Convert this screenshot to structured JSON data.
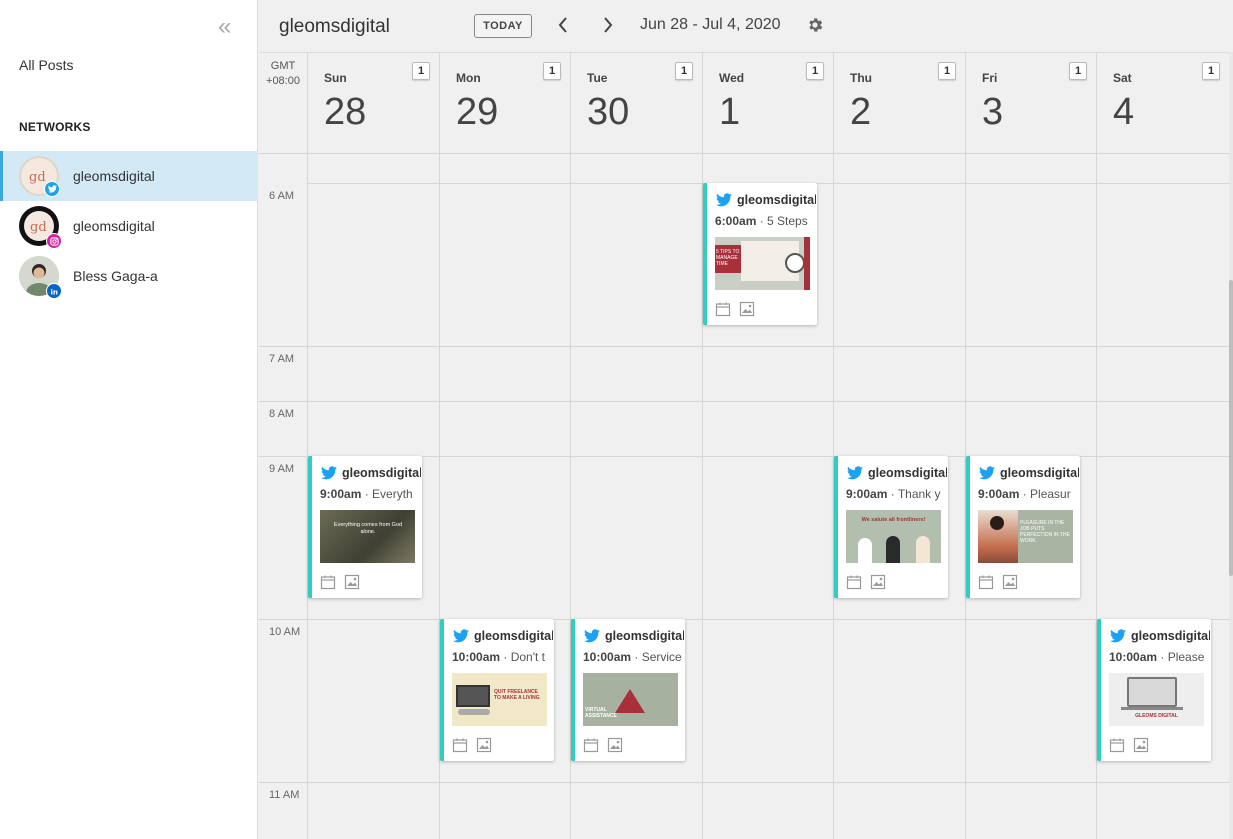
{
  "sidebar": {
    "all_posts": "All Posts",
    "networks_label": "NETWORKS",
    "networks": [
      {
        "name": "gleomsdigital",
        "network": "twitter",
        "avatar_text": "gd"
      },
      {
        "name": "gleomsdigital",
        "network": "instagram",
        "avatar_text": "gd"
      },
      {
        "name": "Bless Gaga-a",
        "network": "linkedin",
        "avatar_text": ""
      }
    ]
  },
  "topbar": {
    "brand": "gleomsdigital",
    "today_label": "TODAY",
    "prev_icon": "chevron-left-icon",
    "next_icon": "chevron-right-icon",
    "date_range": "Jun 28 - Jul 4, 2020",
    "settings_icon": "gear-icon"
  },
  "calendar": {
    "timezone": "GMT\n+08:00",
    "days": [
      {
        "name": "Sun",
        "num": "28",
        "count": "1"
      },
      {
        "name": "Mon",
        "num": "29",
        "count": "1"
      },
      {
        "name": "Tue",
        "num": "30",
        "count": "1"
      },
      {
        "name": "Wed",
        "num": "1",
        "count": "1"
      },
      {
        "name": "Thu",
        "num": "2",
        "count": "1"
      },
      {
        "name": "Fri",
        "num": "3",
        "count": "1"
      },
      {
        "name": "Sat",
        "num": "4",
        "count": "1"
      }
    ],
    "hours": [
      "6 AM",
      "7 AM",
      "8 AM",
      "9 AM",
      "10 AM",
      "11 AM"
    ],
    "posts": [
      {
        "day": 3,
        "hour": 6,
        "account": "gleomsdigital",
        "time": "6:00am",
        "snippet": " · 5 Steps",
        "thumb_color": "#c9cfc4",
        "thumb_text": "5 TIPS TO MANAGE TIME"
      },
      {
        "day": 0,
        "hour": 9,
        "account": "gleomsdigital",
        "time": "9:00am",
        "snippet": " · Everyth",
        "thumb_color": "#5a5e4c",
        "thumb_text": "Everything comes from God alone."
      },
      {
        "day": 4,
        "hour": 9,
        "account": "gleomsdigital",
        "time": "9:00am",
        "snippet": " · Thank y",
        "thumb_color": "#b3bfae",
        "thumb_text": "We salute all frontliners!"
      },
      {
        "day": 5,
        "hour": 9,
        "account": "gleomsdigital",
        "time": "9:00am",
        "snippet": " · Pleasur",
        "thumb_color": "#a9b4a3",
        "thumb_text": "PLEASURE IN THE JOB PUTS PERFECTION IN THE WORK."
      },
      {
        "day": 1,
        "hour": 10,
        "account": "gleomsdigital",
        "time": "10:00am",
        "snippet": " · Don't t",
        "thumb_color": "#f1e8c7",
        "thumb_text": "QUIT FREELANCE TO MAKE A LIVING"
      },
      {
        "day": 2,
        "hour": 10,
        "account": "gleomsdigital",
        "time": "10:00am",
        "snippet": " · Service",
        "thumb_color": "#a7b1a0",
        "thumb_text": "VIRTUAL ASSISTANCE"
      },
      {
        "day": 6,
        "hour": 10,
        "account": "gleomsdigital",
        "time": "10:00am",
        "snippet": " · Please",
        "thumb_color": "#eeeeee",
        "thumb_text": "GLEOMS DIGITAL"
      }
    ]
  },
  "colors": {
    "accent_teal": "#2ecfc0",
    "twitter_blue": "#1da1f2",
    "active_bg": "#d3eaf6"
  }
}
